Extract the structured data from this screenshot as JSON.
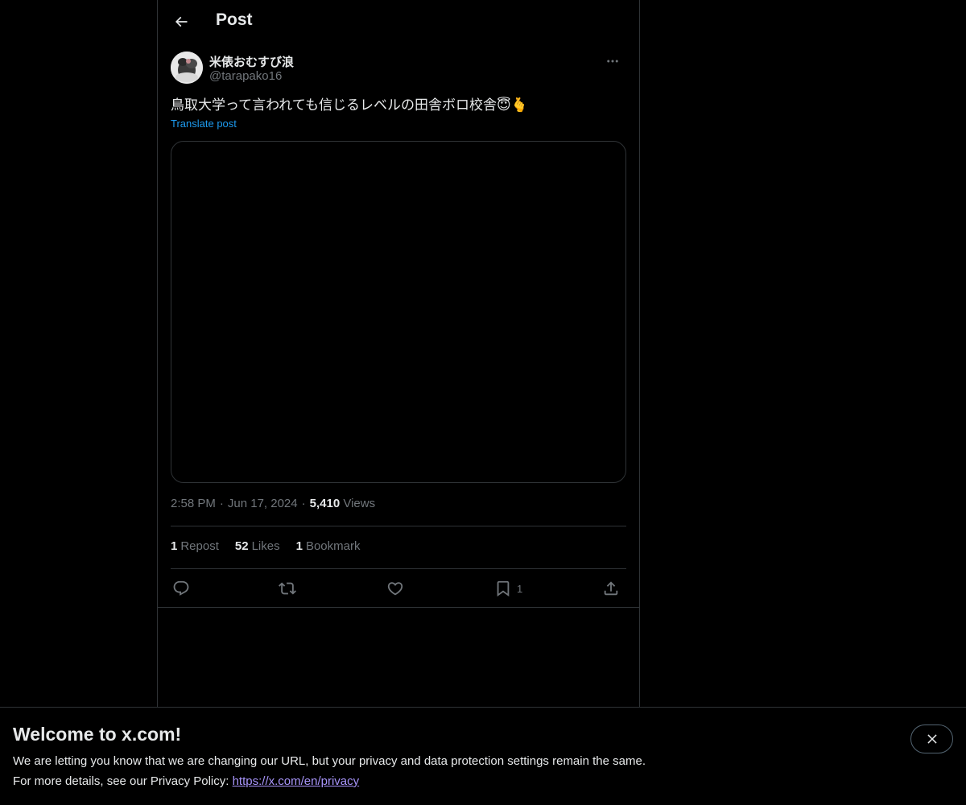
{
  "header": {
    "title": "Post",
    "back_icon": "arrow-left-icon"
  },
  "author": {
    "display_name": "米俵おむすび浪",
    "handle": "@tarapako16",
    "more_icon": "more-horizontal-icon"
  },
  "post": {
    "text": "鳥取大学って言われても信じるレベルの田舎ボロ校舎😇🫰",
    "translate_label": "Translate post",
    "time": "2:58 PM",
    "separator": "·",
    "date": "Jun 17, 2024",
    "views_count": "5,410",
    "views_label": "Views"
  },
  "stats": {
    "reposts_count": "1",
    "reposts_label": "Repost",
    "likes_count": "52",
    "likes_label": "Likes",
    "bookmarks_count": "1",
    "bookmarks_label": "Bookmark"
  },
  "actions": {
    "reply_icon": "reply-icon",
    "repost_icon": "repost-icon",
    "like_icon": "heart-icon",
    "bookmark_icon": "bookmark-icon",
    "bookmark_count": "1",
    "share_icon": "share-icon"
  },
  "banner": {
    "title": "Welcome to x.com!",
    "line1": "We are letting you know that we are changing our URL, but your privacy and data protection settings remain the same.",
    "line2_prefix": "For more details, see our Privacy Policy: ",
    "privacy_link": "https://x.com/en/privacy",
    "close_icon": "close-icon"
  },
  "colors": {
    "background": "#000000",
    "text": "#e7e9ea",
    "muted": "#71767b",
    "accent": "#1d9bf0",
    "link_visited": "#a794f9",
    "border": "#2f3336"
  }
}
